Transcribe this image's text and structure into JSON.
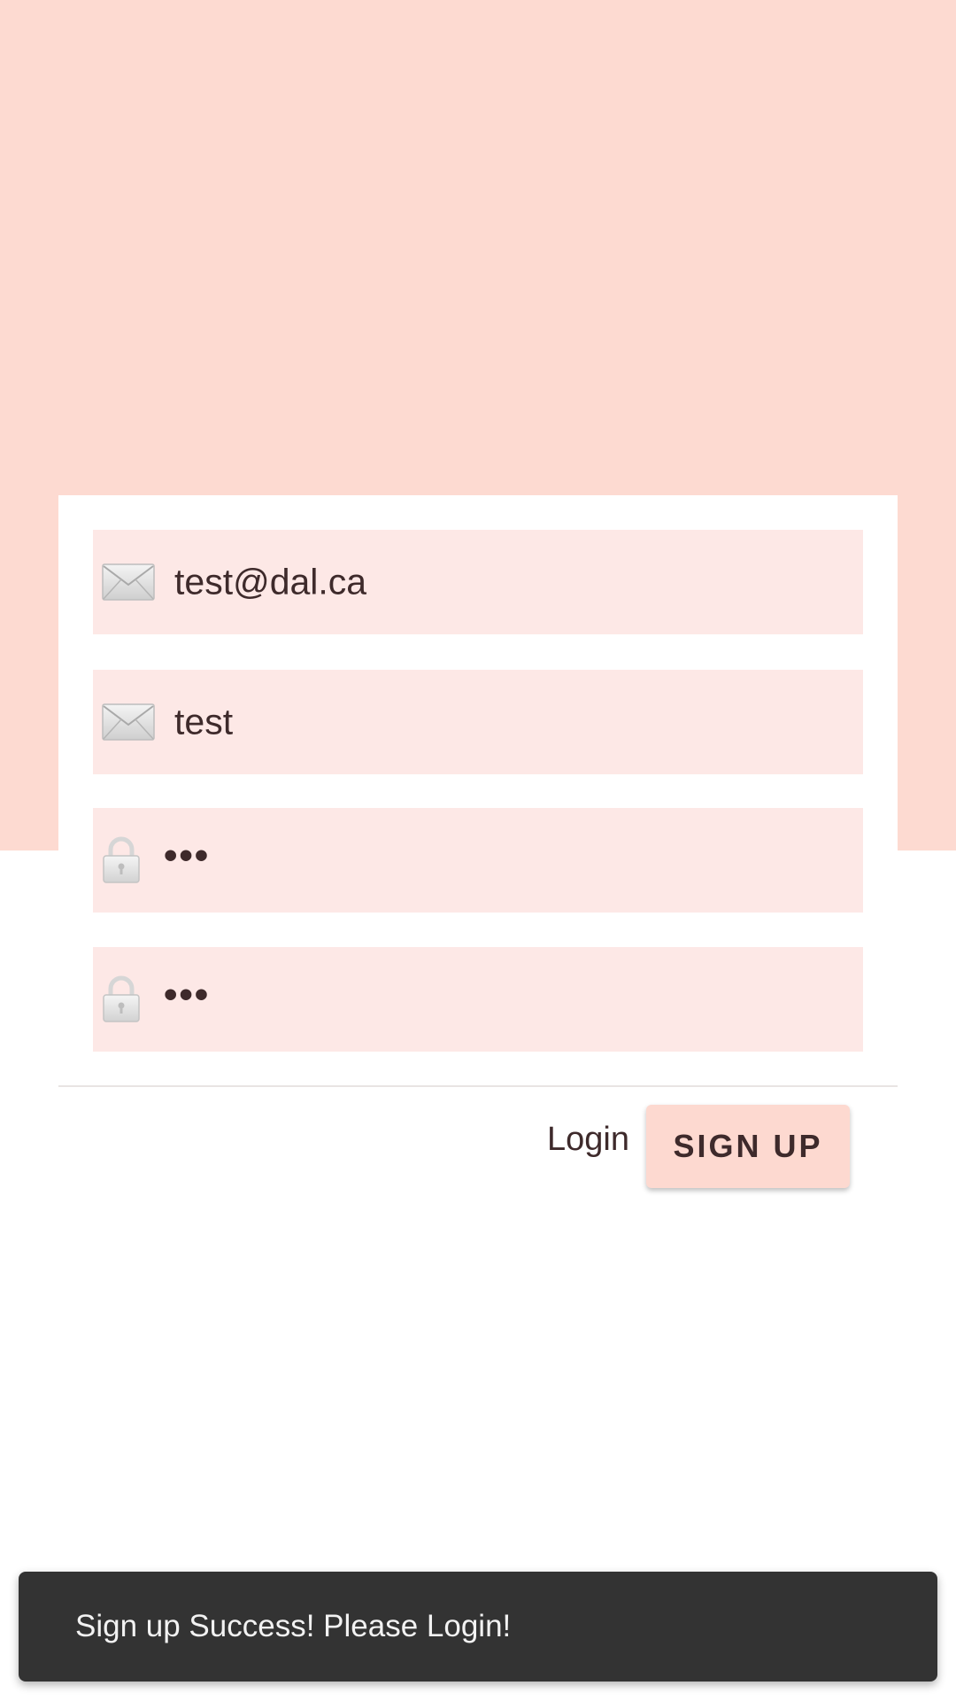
{
  "form": {
    "email_value": "test@dal.ca",
    "username_value": "test",
    "password_value": "•••",
    "confirm_password_value": "•••",
    "email_icon": "envelope-icon",
    "username_icon": "envelope-icon",
    "password_icon": "lock-icon",
    "confirm_password_icon": "lock-icon"
  },
  "actions": {
    "login_label": "Login",
    "signup_label": "SIGN UP"
  },
  "snackbar": {
    "message": "Sign up Success! Please Login!"
  },
  "colors": {
    "accent": "#fddad1",
    "field_background": "#fde8e6",
    "text": "#3e2a2b",
    "snackbar_background": "#333333"
  }
}
